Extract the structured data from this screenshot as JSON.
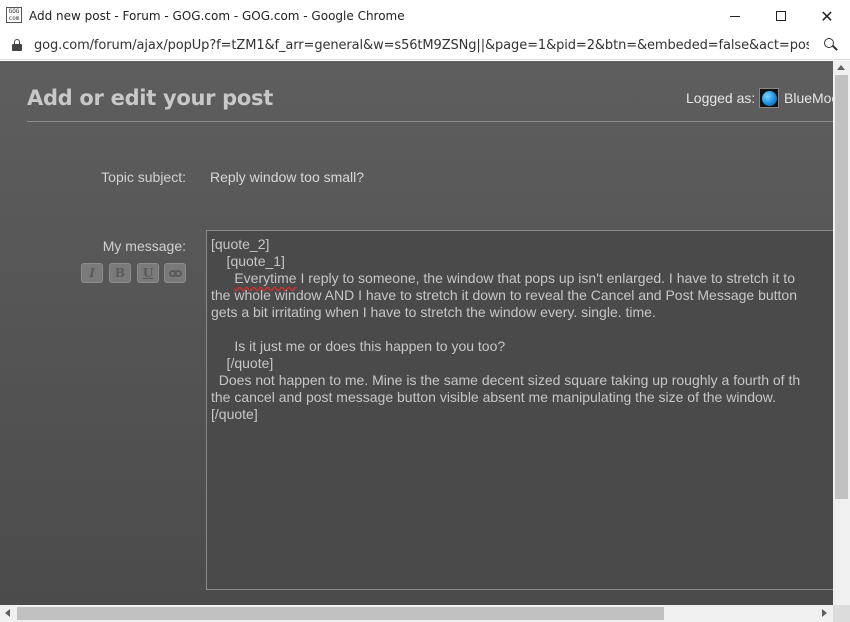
{
  "window": {
    "title": "Add new post - Forum - GOG.com - GOG.com - Google Chrome",
    "favicon_text": "GOG com",
    "close_glyph": "✕"
  },
  "address": {
    "url": "gog.com/forum/ajax/popUp?f=tZM1&f_arr=general&w=s56tM9ZSNg||&page=1&pid=2&btn=&embeded=false&act=post..."
  },
  "header": {
    "title": "Add or edit your post",
    "logged_as_label": "Logged as:",
    "username": "BlueMoo"
  },
  "form": {
    "subject_label": "Topic subject:",
    "subject_value": "Reply window too small?",
    "message_label": "My message:",
    "format_buttons": {
      "italic": "I",
      "bold": "B",
      "underline": "U"
    },
    "message_lines": [
      "[quote_2]",
      "    [quote_1]",
      "      ",
      "Everytime",
      " I reply to someone, the window that pops up isn't enlarged. I have to stretch it to",
      "the whole window AND I have to stretch it down to reveal the Cancel and Post Message button",
      "gets a bit irritating when I have to stretch the window every. single. time.",
      "",
      "      Is it just me or does this happen to you too?",
      "    [/quote]",
      "  Does not happen to me. Mine is the same decent sized square taking up roughly a fourth of th",
      "the cancel and post message button visible absent me manipulating the size of the window.",
      "[/quote]"
    ]
  },
  "colors": {
    "page_bg": "#555555",
    "text": "#c6c6c6",
    "title": "#c8c8c8",
    "spell_error": "#d03030"
  }
}
